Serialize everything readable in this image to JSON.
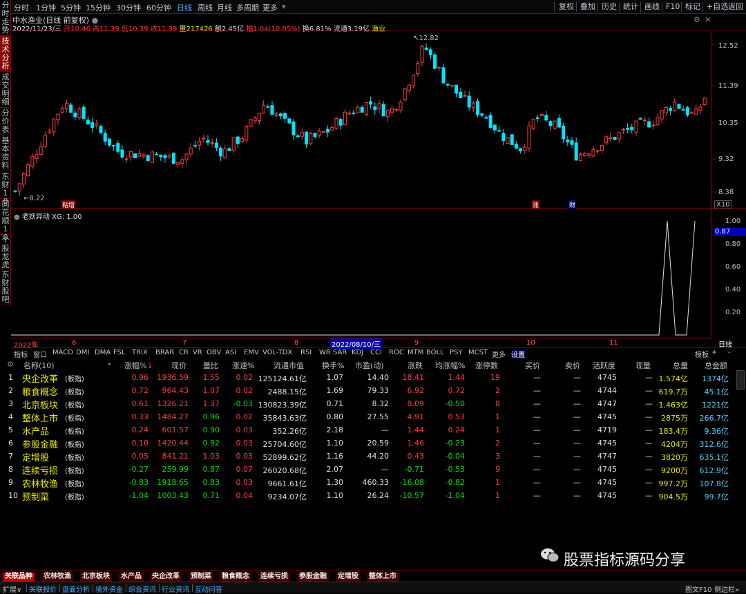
{
  "left_tabs": [
    "分时走势",
    "技术分析",
    "成交明细",
    "分价表",
    "基本资料",
    "东财10",
    "同花顺10",
    "个股龙虎",
    "东财股吧"
  ],
  "period_tabs": [
    "分时",
    "1分钟",
    "5分钟",
    "15分钟",
    "30分钟",
    "60分钟",
    "日线",
    "周线",
    "月线",
    "多周期",
    "更多"
  ],
  "right_buttons": [
    "复权",
    "叠加",
    "历史",
    "统计",
    "画线",
    "F10",
    "标记",
    "+自选",
    "返回"
  ],
  "title": "中水渔业(日线 前复权)",
  "info": {
    "date": "2022/11/23/三",
    "open_lbl": "开",
    "open": "10.46",
    "high_lbl": "高",
    "high": "11.39",
    "low_lbl": "低",
    "low": "10.39",
    "close_lbl": "收",
    "close": "11.39",
    "vol_lbl": "量",
    "vol": "217426",
    "amt_lbl": "额",
    "amt": "2.45亿",
    "chg_lbl": "幅",
    "chg": "1.04(10.05%)",
    "turn": "换6.81%",
    "float": "流通3.19亿",
    "sector": "渔业"
  },
  "price_axis": [
    "12.52",
    "11.39",
    "10.35",
    "9.32",
    "8.38"
  ],
  "price_marks": {
    "high": "12.82",
    "low": "8.22"
  },
  "chart_tags": [
    "粘增",
    "涨",
    "财"
  ],
  "x10": "X10",
  "indicator_title": "老妖异动",
  "indicator_param": "XG: 1.00",
  "ind_axis": [
    "1.00",
    "0.80",
    "0.60",
    "0.40",
    "0.20"
  ],
  "ind_current": "0.87",
  "date_axis": [
    "2022年",
    "6",
    "7",
    "8",
    "2022/08/10/三",
    "9",
    "10",
    "11"
  ],
  "date_right": "日线",
  "chart_data": {
    "type": "candlestick",
    "price_range": [
      8.22,
      12.82
    ],
    "indicator_signal": {
      "name": "XG",
      "values_range": [
        0,
        1
      ]
    }
  },
  "ind_tabs": [
    "指标",
    "窗口",
    "MACD",
    "DMI",
    "DMA",
    "FSL",
    "TRIX",
    "BRAR",
    "CR",
    "VR",
    "OBV",
    "ASI",
    "EMV",
    "VOL-TDX",
    "RSI",
    "WR",
    "SAR",
    "KDJ",
    "CCI",
    "ROC",
    "MTM",
    "BOLL",
    "PSY",
    "MCST",
    "更多",
    "设置"
  ],
  "ind_tabs_right": [
    "模板",
    "+",
    "-"
  ],
  "table": {
    "headers": [
      "名称(10)",
      "涨幅%",
      "现价",
      "量比",
      "涨速%",
      "流通市值",
      "换手%",
      "市盈(动)",
      "涨跌",
      "均涨幅%",
      "涨停数",
      "买价",
      "卖价",
      "活跃度",
      "现量",
      "总量",
      "总金额"
    ],
    "rows": [
      [
        "1",
        "央企改革",
        "(板指)",
        "0.96",
        "1936.59",
        "1.55",
        "0.02",
        "125124.61亿",
        "1.07",
        "14.40",
        "18.41",
        "1.44",
        "19",
        "—",
        "—",
        "4745",
        "—",
        "1.574亿",
        "1374亿"
      ],
      [
        "2",
        "粮食概念",
        "(板指)",
        "0.72",
        "964.43",
        "1.07",
        "0.02",
        "2488.15亿",
        "1.69",
        "79.33",
        "6.92",
        "0.72",
        "2",
        "—",
        "—",
        "4744",
        "—",
        "619.7万",
        "45.1亿"
      ],
      [
        "3",
        "北京板块",
        "(板指)",
        "0.61",
        "1326.21",
        "1.37",
        "-0.03",
        "130823.39亿",
        "0.71",
        "8.32",
        "8.09",
        "-0.50",
        "8",
        "—",
        "—",
        "4747",
        "—",
        "1.463亿",
        "1221亿"
      ],
      [
        "4",
        "整体上市",
        "(板指)",
        "0.33",
        "1484.27",
        "0.96",
        "0.02",
        "35843.63亿",
        "0.80",
        "27.55",
        "4.91",
        "0.53",
        "1",
        "—",
        "—",
        "4745",
        "—",
        "2875万",
        "266.7亿"
      ],
      [
        "5",
        "水产品",
        "(板指)",
        "0.24",
        "601.57",
        "0.90",
        "0.03",
        "352.26亿",
        "2.18",
        "—",
        "1.44",
        "0.24",
        "1",
        "—",
        "—",
        "4719",
        "—",
        "183.4万",
        "9.36亿"
      ],
      [
        "6",
        "参股金融",
        "(板指)",
        "0.10",
        "1420.44",
        "0.92",
        "0.03",
        "25704.60亿",
        "1.10",
        "20.59",
        "1.46",
        "-0.23",
        "2",
        "—",
        "—",
        "4745",
        "—",
        "4204万",
        "312.6亿"
      ],
      [
        "7",
        "定增股",
        "(板指)",
        "0.05",
        "841.21",
        "1.03",
        "0.03",
        "52899.62亿",
        "1.16",
        "44.20",
        "0.43",
        "-0.04",
        "3",
        "—",
        "—",
        "4747",
        "—",
        "3820万",
        "635.1亿"
      ],
      [
        "8",
        "连续亏损",
        "(板指)",
        "-0.27",
        "259.99",
        "0.87",
        "0.07",
        "26020.68亿",
        "2.07",
        "—",
        "-0.71",
        "-0.53",
        "9",
        "—",
        "—",
        "4745",
        "—",
        "9200万",
        "612.9亿"
      ],
      [
        "9",
        "农林牧渔",
        "(板指)",
        "-0.83",
        "1918.65",
        "0.83",
        "0.03",
        "9661.61亿",
        "1.30",
        "460.33",
        "-16.08",
        "-0.82",
        "1",
        "—",
        "—",
        "4745",
        "—",
        "997.2万",
        "107.8亿"
      ],
      [
        "10",
        "预制菜",
        "(板指)",
        "-1.04",
        "1003.43",
        "0.71",
        "0.04",
        "9234.07亿",
        "1.10",
        "26.24",
        "-10.57",
        "-1.04",
        "1",
        "—",
        "—",
        "4745",
        "—",
        "904.5万",
        "99.7亿"
      ]
    ]
  },
  "watermark": "股票指标源码分享",
  "bottom_tabs": [
    "关联品种",
    "农林牧渔",
    "北京板块",
    "水产品",
    "央企改革",
    "预制菜",
    "粮食概念",
    "连续亏损",
    "参股金融",
    "定增股",
    "整体上市"
  ],
  "status": [
    "扩展∨",
    "关联报价",
    "盘面分析",
    "境外资金",
    "综合资讯",
    "行业资讯",
    "互动问答"
  ],
  "status_right": [
    "图文F10",
    "侧边栏»"
  ],
  "colors": {
    "up": "#ff3b3b",
    "down": "#00ffff",
    "accent": "#8a0000"
  }
}
